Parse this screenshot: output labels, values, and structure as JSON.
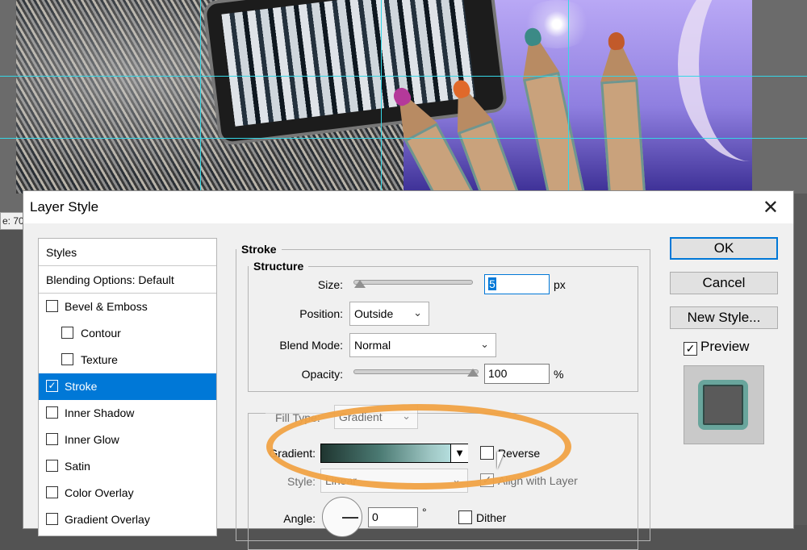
{
  "canvas": {
    "status_fragment": "e: 70"
  },
  "dialog": {
    "title": "Layer Style",
    "close_glyph": "✕",
    "styles_list": {
      "header": "Styles",
      "blending": "Blending Options: Default",
      "items": [
        {
          "label": "Bevel & Emboss",
          "checked": false,
          "sub": false
        },
        {
          "label": "Contour",
          "checked": false,
          "sub": true
        },
        {
          "label": "Texture",
          "checked": false,
          "sub": true
        },
        {
          "label": "Stroke",
          "checked": true,
          "sub": false,
          "selected": true
        },
        {
          "label": "Inner Shadow",
          "checked": false,
          "sub": false
        },
        {
          "label": "Inner Glow",
          "checked": false,
          "sub": false
        },
        {
          "label": "Satin",
          "checked": false,
          "sub": false
        },
        {
          "label": "Color Overlay",
          "checked": false,
          "sub": false
        },
        {
          "label": "Gradient Overlay",
          "checked": false,
          "sub": false
        }
      ]
    },
    "stroke": {
      "section_title": "Stroke",
      "structure": {
        "title": "Structure",
        "size_label": "Size:",
        "size_value": "5",
        "size_unit": "px",
        "position_label": "Position:",
        "position_value": "Outside",
        "blend_mode_label": "Blend Mode:",
        "blend_mode_value": "Normal",
        "opacity_label": "Opacity:",
        "opacity_value": "100",
        "opacity_unit": "%"
      },
      "fill": {
        "fill_type_label": "Fill Type:",
        "fill_type_value": "Gradient",
        "gradient_label": "Gradient:",
        "reverse_label": "Reverse",
        "reverse_checked": false,
        "style_label": "Style:",
        "style_value": "Linear",
        "align_label": "Align with Layer",
        "align_checked": true,
        "angle_label": "Angle:",
        "angle_value": "0",
        "angle_unit": "°",
        "dither_label": "Dither",
        "dither_checked": false
      }
    },
    "buttons": {
      "ok": "OK",
      "cancel": "Cancel",
      "new_style": "New Style...",
      "preview_label": "Preview",
      "preview_checked": true
    },
    "colors": {
      "selection": "#0078d7",
      "highlight_ellipse": "#f0a244",
      "gradient_start": "#1f3530",
      "gradient_end": "#c6f0f3"
    },
    "icons": [
      "close-icon",
      "checkmark-icon",
      "chevron-down-icon",
      "mouse-cursor-icon"
    ]
  }
}
